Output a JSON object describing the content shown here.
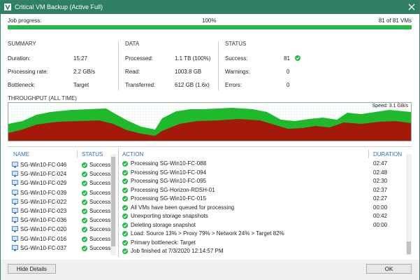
{
  "window": {
    "title": "Critical VM Backup (Active Full)"
  },
  "progress": {
    "label": "Job progress:",
    "percent_text": "100%",
    "count_text": "81 of 81 VMs",
    "fraction": 1.0
  },
  "summary": {
    "title": "SUMMARY",
    "duration_label": "Duration:",
    "duration": "15:27",
    "rate_label": "Processing rate:",
    "rate": "2.2 GB/s",
    "bottleneck_label": "Bottleneck:",
    "bottleneck": "Target"
  },
  "data_section": {
    "title": "DATA",
    "processed_label": "Processed:",
    "processed": "1.1 TB (100%)",
    "read_label": "Read:",
    "read": "1003.8 GB",
    "transferred_label": "Transferred:",
    "transferred": "612 GB (1.6x)"
  },
  "status": {
    "title": "STATUS",
    "success_label": "Success:",
    "success": "81",
    "warnings_label": "Warnings:",
    "warnings": "0",
    "errors_label": "Errors:",
    "errors": "0"
  },
  "throughput": {
    "title": "THROUGHPUT (ALL TIME)",
    "speed": "Speed: 3.1 GB/s"
  },
  "vm_list": {
    "name_header": "NAME",
    "status_header": "STATUS",
    "rows": [
      {
        "name": "SG-Win10-FC-046",
        "status": "Success"
      },
      {
        "name": "SG-Win10-FC-024",
        "status": "Success"
      },
      {
        "name": "SG-Win10-FC-029",
        "status": "Success"
      },
      {
        "name": "SG-Win10-FC-039",
        "status": "Success"
      },
      {
        "name": "SG-Win10-FC-022",
        "status": "Success"
      },
      {
        "name": "SG-Win10-FC-023",
        "status": "Success"
      },
      {
        "name": "SG-Win10-FC-036",
        "status": "Success"
      },
      {
        "name": "SG-Win10-FC-020",
        "status": "Success"
      },
      {
        "name": "SG-Win10-FC-016",
        "status": "Success"
      },
      {
        "name": "SG-Win10-FC-037",
        "status": "Success"
      }
    ]
  },
  "action_list": {
    "action_header": "ACTION",
    "duration_header": "DURATION",
    "rows": [
      {
        "action": "Processing SG-Win10-FC-088",
        "duration": "02:47"
      },
      {
        "action": "Processing SG-Win10-FC-094",
        "duration": "02:48"
      },
      {
        "action": "Processing SG-Win10-FC-095",
        "duration": "02:30"
      },
      {
        "action": "Processing SG-Horizon-RDSH-01",
        "duration": "02:37"
      },
      {
        "action": "Processing SG-Win10-FC-015",
        "duration": "02:27"
      },
      {
        "action": "All VMs have been queued for processing",
        "duration": "00:00"
      },
      {
        "action": "Unexporting storage snapshots",
        "duration": "00:42"
      },
      {
        "action": "Deleting storage snapshot",
        "duration": "00:00"
      },
      {
        "action": "Load: Source 13% > Proxy 79% > Network 24% > Target 82%",
        "duration": ""
      },
      {
        "action": "Primary bottleneck: Target",
        "duration": ""
      },
      {
        "action": "Job finished at 7/3/2020 12:14:57 PM",
        "duration": ""
      }
    ]
  },
  "buttons": {
    "hide_details": "Hide Details",
    "ok": "OK"
  },
  "colors": {
    "titlebar": "#2f7f63",
    "progress": "#29b94a",
    "chart_green": "#1fba2b",
    "chart_red": "#a31a0b",
    "link_blue": "#2f6fb4"
  },
  "icons": {
    "app": "veeam-icon",
    "close": "close-icon",
    "vm": "vm-icon",
    "success": "check-circle-icon"
  }
}
